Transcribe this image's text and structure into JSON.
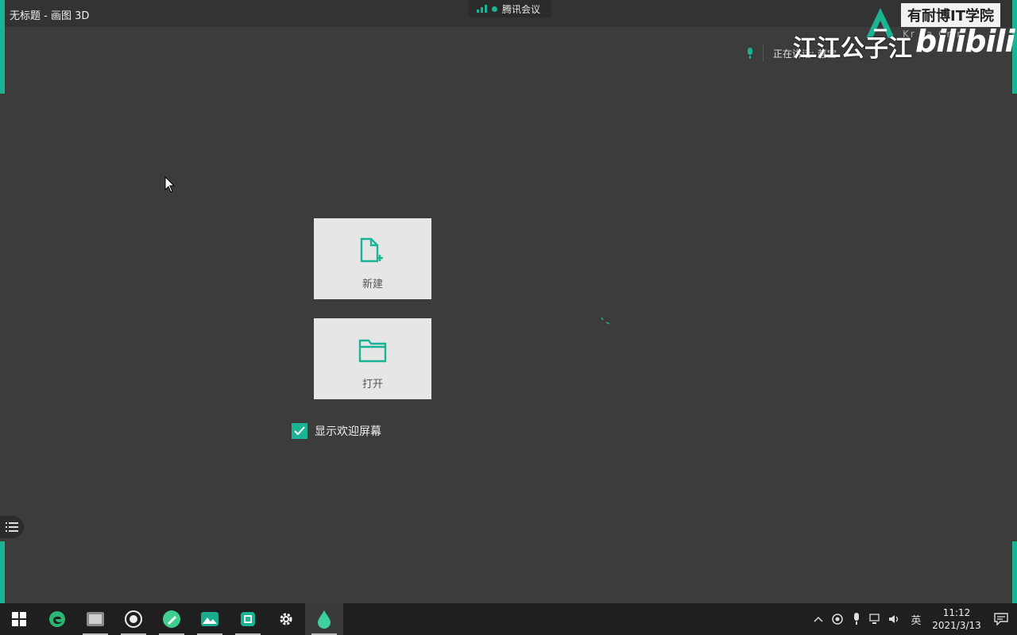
{
  "window": {
    "title": "无标题 - 画图 3D"
  },
  "meeting": {
    "app_name": "腾讯会议",
    "accent": "#1ab394"
  },
  "speaking": {
    "label": "正在讲话: 赵宝"
  },
  "watermark": {
    "brand": "有耐博IT学院",
    "sub": "Kr  Ta  Cr r",
    "author": "江江公子江",
    "site": "bilibili"
  },
  "welcome": {
    "new_label": "新建",
    "open_label": "打开",
    "show_welcome_label": "显示欢迎屏幕",
    "show_welcome_checked": true
  },
  "taskbar": {
    "apps": [
      {
        "name": "start-icon"
      },
      {
        "name": "edge-icon"
      },
      {
        "name": "media-app-icon"
      },
      {
        "name": "record-app-icon"
      },
      {
        "name": "pen-app-icon"
      },
      {
        "name": "photos-icon"
      },
      {
        "name": "screen-capture-icon"
      },
      {
        "name": "settings-gear-icon"
      },
      {
        "name": "paint3d-icon"
      }
    ],
    "tray": {
      "ime_label": "英",
      "time": "11:12",
      "date": "2021/3/13"
    }
  }
}
